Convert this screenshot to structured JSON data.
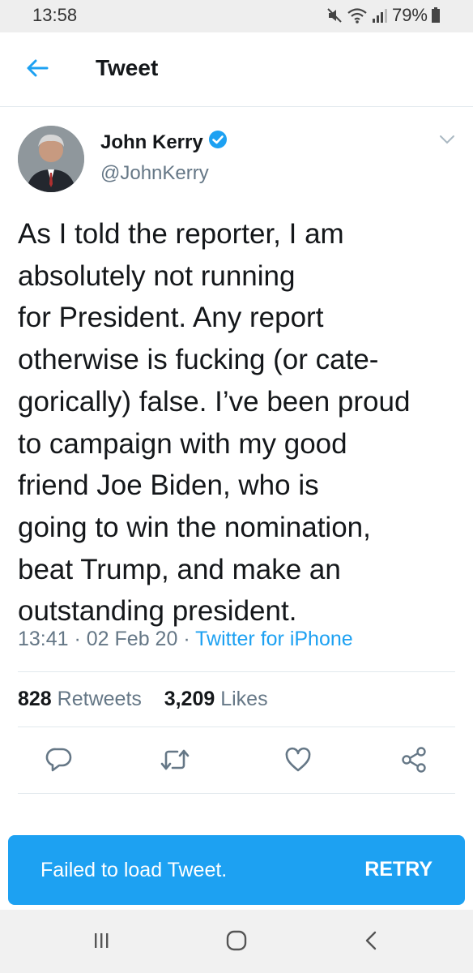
{
  "status_bar": {
    "time": "13:58",
    "battery": "79%"
  },
  "header": {
    "title": "Tweet"
  },
  "tweet": {
    "author_name": "John Kerry",
    "handle": "@JohnKerry",
    "text_lines": [
      "As I told the reporter, I am",
      "absolutely not running",
      "for President. Any report",
      "otherwise is fucking (or cate-",
      "gorically) false. I’ve been proud",
      "to campaign with my good",
      "friend Joe Biden, who is",
      "going to win the nomination,",
      "beat Trump, and make an",
      "outstanding president."
    ],
    "time": "13:41",
    "date": "02 Feb 20",
    "source": "Twitter for iPhone",
    "separator": " · ",
    "retweets_count": "828",
    "retweets_label": "Retweets",
    "likes_count": "3,209",
    "likes_label": "Likes"
  },
  "snackbar": {
    "message": "Failed to load Tweet.",
    "action": "RETRY"
  },
  "colors": {
    "accent": "#1da1f2",
    "secondary_text": "#657786",
    "primary_text": "#14171a"
  },
  "icons": {
    "back": "arrow-left-icon",
    "verified": "verified-badge-icon",
    "caret": "chevron-down-icon",
    "reply": "reply-icon",
    "retweet": "retweet-icon",
    "like": "heart-icon",
    "share": "share-icon"
  }
}
